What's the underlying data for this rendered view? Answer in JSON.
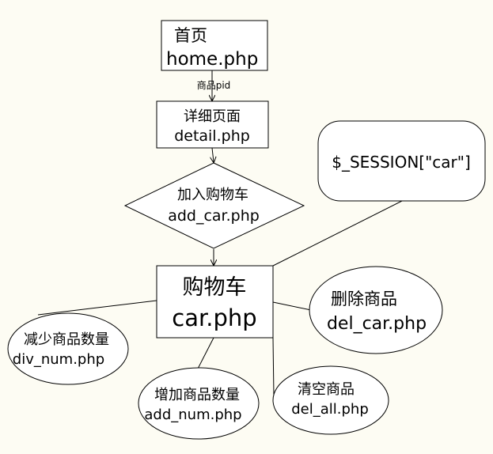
{
  "colors": {
    "background": "#fdfcf3",
    "shape_fill": "#ffffff",
    "stroke": "#000000",
    "text": "#000000"
  },
  "nodes": {
    "home": {
      "line1": "首页",
      "line2": "home.php"
    },
    "detail": {
      "line1": "详细页面",
      "line2": "detail.php"
    },
    "add_car": {
      "line1": "加入购物车",
      "line2": "add_car.php"
    },
    "session": {
      "label": "$_SESSION[\"car\"]"
    },
    "car": {
      "line1": "购物车",
      "line2": "car.php"
    },
    "del_car": {
      "line1": "删除商品",
      "line2": "del_car.php"
    },
    "div_num": {
      "line1": "减少商品数量",
      "line2": "div_num.php"
    },
    "add_num": {
      "line1": "增加商品数量",
      "line2": "add_num.php"
    },
    "del_all": {
      "line1": "清空商品",
      "line2": "del_all.php"
    }
  },
  "edges": {
    "home_to_detail_label": "商品pid"
  }
}
